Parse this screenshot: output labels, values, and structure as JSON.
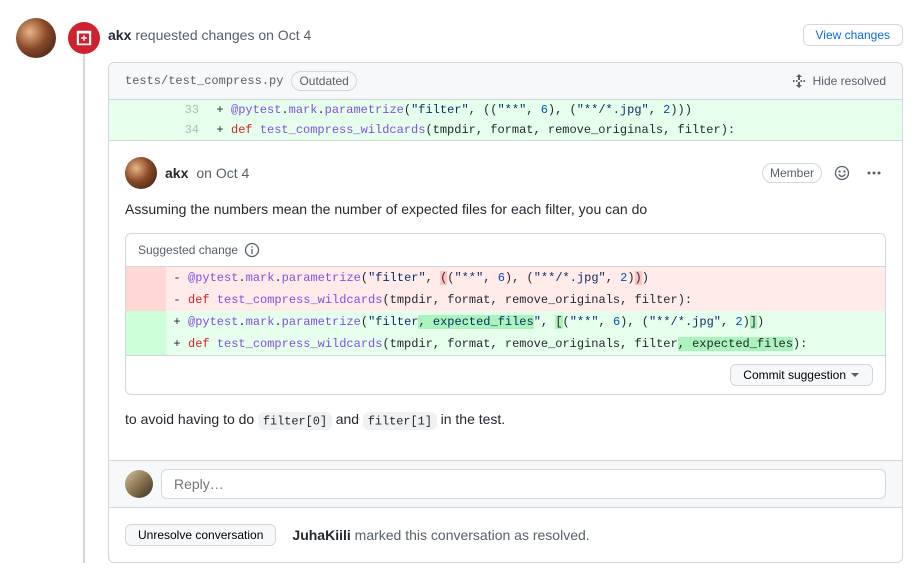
{
  "review": {
    "author": "akx",
    "action_text": "requested changes on Oct 4",
    "view_changes_label": "View changes"
  },
  "file": {
    "path": "tests/test_compress.py",
    "outdated_label": "Outdated",
    "hide_resolved_label": "Hide resolved"
  },
  "diff": {
    "lines": [
      {
        "lnL": "",
        "lnR": "33",
        "marker": "+",
        "type": "add",
        "tokens": "<span class=\"tk-dec\">@pytest</span>.<span class=\"tk-fn\">mark</span>.<span class=\"tk-fn\">parametrize</span>(<span class=\"tk-str\">\"filter\"</span>, ((<span class=\"tk-str\">\"**\"</span>, <span class=\"tk-num\">6</span>), (<span class=\"tk-str\">\"**/*.jpg\"</span>, <span class=\"tk-num\">2</span>)))"
      },
      {
        "lnL": "",
        "lnR": "34",
        "marker": "+",
        "type": "add",
        "tokens": "<span class=\"tk-kw\">def</span> <span class=\"tk-fn\">test_compress_wildcards</span>(tmpdir, format, remove_originals, filter):"
      }
    ]
  },
  "comment": {
    "author": "akx",
    "time": "on Oct 4",
    "member_label": "Member",
    "body_before": "Assuming the numbers mean the number of expected files for each filter, you can do",
    "body_after_1": "to avoid having to do ",
    "body_after_code1": "filter[0]",
    "body_after_2": " and ",
    "body_after_code2": "filter[1]",
    "body_after_3": " in the test.",
    "suggested_change_label": "Suggested change",
    "commit_suggestion_label": "Commit suggestion"
  },
  "suggest": {
    "lines": [
      {
        "marker": "-",
        "type": "del",
        "tokens": "<span class=\"tk-dec\">@pytest</span>.<span class=\"tk-fn\">mark</span>.<span class=\"tk-fn\">parametrize</span>(<span class=\"tk-str\">\"filter\"</span>, <span class=\"hl\" style=\"background:#ffc4c0\">(</span>(<span class=\"tk-str\">\"**\"</span>, <span class=\"tk-num\">6</span>), (<span class=\"tk-str\">\"**/*.jpg\"</span>, <span class=\"tk-num\">2</span>)<span class=\"hl\" style=\"background:#ffc4c0\">)</span>)"
      },
      {
        "marker": "-",
        "type": "del",
        "tokens": "<span class=\"tk-kw\">def</span> <span class=\"tk-fn\">test_compress_wildcards</span>(tmpdir, format, remove_originals, filter):"
      },
      {
        "marker": "+",
        "type": "add",
        "tokens": "<span class=\"tk-dec\">@pytest</span>.<span class=\"tk-fn\">mark</span>.<span class=\"tk-fn\">parametrize</span>(<span class=\"tk-str\">\"filter<span class=\"hl\">, expected_files</span>\"</span>, <span class=\"hl\">[</span>(<span class=\"tk-str\">\"**\"</span>, <span class=\"tk-num\">6</span>), (<span class=\"tk-str\">\"**/*.jpg\"</span>, <span class=\"tk-num\">2</span>)<span class=\"hl\">]</span>)"
      },
      {
        "marker": "+",
        "type": "add",
        "tokens": "<span class=\"tk-kw\">def</span> <span class=\"tk-fn\">test_compress_wildcards</span>(tmpdir, format, remove_originals, filter<span class=\"hl\">, expected_files</span>):"
      }
    ]
  },
  "reply": {
    "placeholder": "Reply…"
  },
  "resolve": {
    "button_label": "Unresolve conversation",
    "marker_user": "JuhaKiili",
    "marker_text": " marked this conversation as resolved."
  }
}
